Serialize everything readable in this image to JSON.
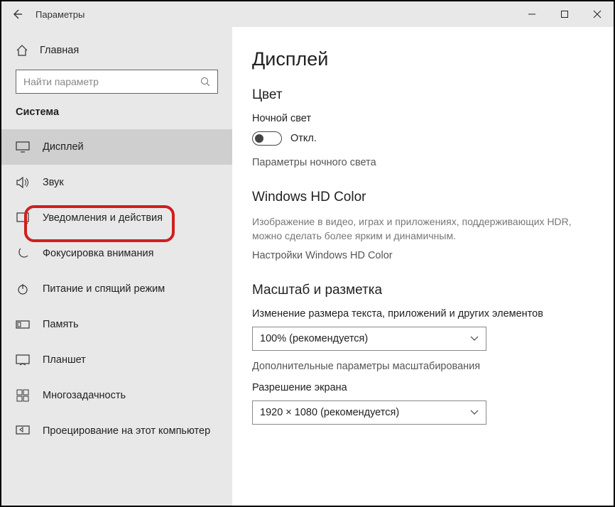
{
  "titlebar": {
    "title": "Параметры"
  },
  "sidebar": {
    "home": "Главная",
    "search_placeholder": "Найти параметр",
    "section": "Система",
    "items": [
      {
        "label": "Дисплей"
      },
      {
        "label": "Звук"
      },
      {
        "label": "Уведомления и действия"
      },
      {
        "label": "Фокусировка внимания"
      },
      {
        "label": "Питание и спящий режим"
      },
      {
        "label": "Память"
      },
      {
        "label": "Планшет"
      },
      {
        "label": "Многозадачность"
      },
      {
        "label": "Проецирование на этот компьютер"
      }
    ]
  },
  "main": {
    "page_title": "Дисплей",
    "color": {
      "heading": "Цвет",
      "night_light_label": "Ночной свет",
      "toggle_state": "Откл.",
      "night_light_settings": "Параметры ночного света"
    },
    "hd": {
      "heading": "Windows HD Color",
      "desc": "Изображение в видео, играх и приложениях, поддерживающих HDR, можно сделать более ярким и динамичным.",
      "link": "Настройки Windows HD Color"
    },
    "scale": {
      "heading": "Масштаб и разметка",
      "scale_label": "Изменение размера текста, приложений и других элементов",
      "scale_value": "100% (рекомендуется)",
      "advanced": "Дополнительные параметры масштабирования",
      "resolution_label": "Разрешение экрана",
      "resolution_value": "1920 × 1080 (рекомендуется)"
    }
  }
}
